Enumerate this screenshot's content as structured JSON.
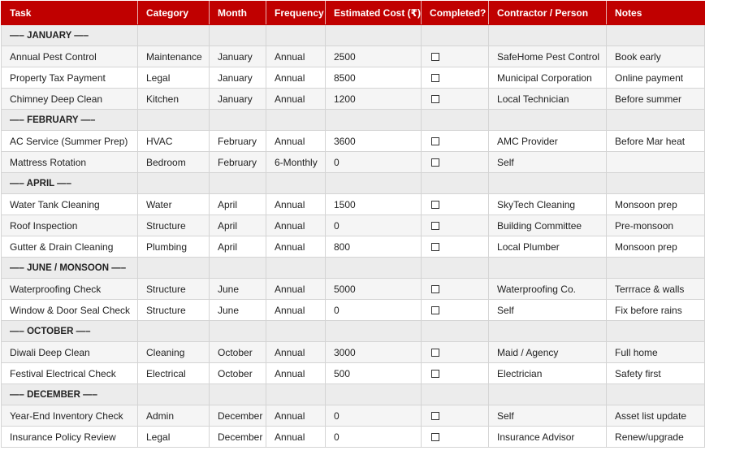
{
  "headers": [
    "Task",
    "Category",
    "Month",
    "Frequency",
    "Estimated Cost (₹)",
    "Completed?",
    "Contractor / Person",
    "Notes"
  ],
  "rows": [
    {
      "type": "section",
      "label": "—– JANUARY —–"
    },
    {
      "type": "item",
      "cells": [
        "Annual Pest Control",
        "Maintenance",
        "January",
        "Annual",
        "2500",
        "",
        "SafeHome Pest Control",
        "Book early"
      ]
    },
    {
      "type": "item",
      "cells": [
        "Property Tax Payment",
        "Legal",
        "January",
        "Annual",
        "8500",
        "",
        "Municipal Corporation",
        "Online payment"
      ]
    },
    {
      "type": "item",
      "cells": [
        "Chimney Deep Clean",
        "Kitchen",
        "January",
        "Annual",
        "1200",
        "",
        "Local Technician",
        "Before summer"
      ]
    },
    {
      "type": "section",
      "label": "—– FEBRUARY —–"
    },
    {
      "type": "item",
      "cells": [
        "AC Service (Summer Prep)",
        "HVAC",
        "February",
        "Annual",
        "3600",
        "",
        "AMC Provider",
        "Before Mar heat"
      ]
    },
    {
      "type": "item",
      "cells": [
        "Mattress Rotation",
        "Bedroom",
        "February",
        "6-Monthly",
        "0",
        "",
        "Self",
        ""
      ]
    },
    {
      "type": "section",
      "label": "—– APRIL —–"
    },
    {
      "type": "item",
      "cells": [
        "Water Tank Cleaning",
        "Water",
        "April",
        "Annual",
        "1500",
        "",
        "SkyTech Cleaning",
        "Monsoon prep"
      ]
    },
    {
      "type": "item",
      "cells": [
        "Roof Inspection",
        "Structure",
        "April",
        "Annual",
        "0",
        "",
        "Building Committee",
        "Pre-monsoon"
      ]
    },
    {
      "type": "item",
      "cells": [
        "Gutter & Drain Cleaning",
        "Plumbing",
        "April",
        "Annual",
        "800",
        "",
        "Local Plumber",
        "Monsoon prep"
      ]
    },
    {
      "type": "section",
      "label": "—– JUNE / MONSOON —–"
    },
    {
      "type": "item",
      "cells": [
        "Waterproofing Check",
        "Structure",
        "June",
        "Annual",
        "5000",
        "",
        "Waterproofing Co.",
        "Terrrace & walls"
      ]
    },
    {
      "type": "item",
      "cells": [
        "Window & Door Seal Check",
        "Structure",
        "June",
        "Annual",
        "0",
        "",
        "Self",
        "Fix before rains"
      ]
    },
    {
      "type": "section",
      "label": "—– OCTOBER —–"
    },
    {
      "type": "item",
      "cells": [
        "Diwali Deep Clean",
        "Cleaning",
        "October",
        "Annual",
        "3000",
        "",
        "Maid / Agency",
        "Full home"
      ]
    },
    {
      "type": "item",
      "cells": [
        "Festival Electrical Check",
        "Electrical",
        "October",
        "Annual",
        "500",
        "",
        "Electrician",
        "Safety first"
      ]
    },
    {
      "type": "section",
      "label": "—– DECEMBER —–"
    },
    {
      "type": "item",
      "cells": [
        "Year-End Inventory Check",
        "Admin",
        "December",
        "Annual",
        "0",
        "",
        "Self",
        "Asset list update"
      ]
    },
    {
      "type": "item",
      "cells": [
        "Insurance Policy Review",
        "Legal",
        "December",
        "Annual",
        "0",
        "",
        "Insurance Advisor",
        "Renew/upgrade"
      ]
    }
  ],
  "colors": {
    "header_bg": "#c00000",
    "header_text": "#ffffff",
    "section_bg": "#ececec",
    "alt_row_bg": "#f5f5f5",
    "grid": "#d4d4d4"
  },
  "icons": {
    "checkbox": "checkbox-icon"
  }
}
